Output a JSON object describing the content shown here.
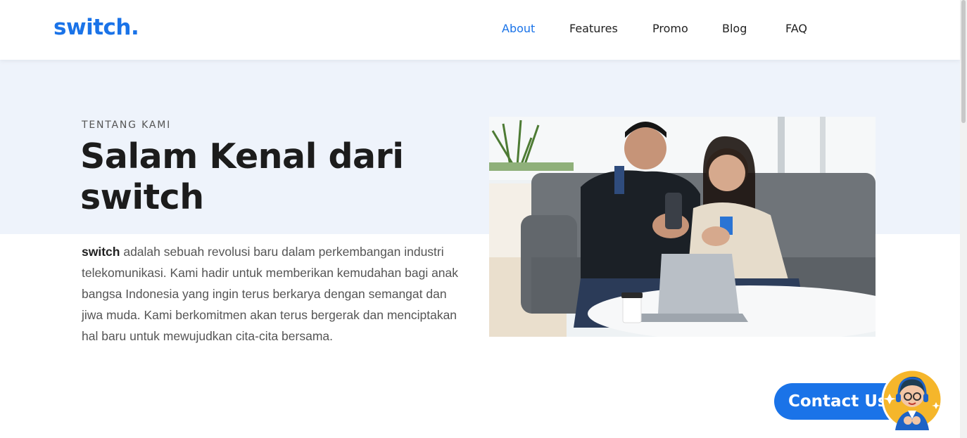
{
  "header": {
    "logo": "switch.",
    "nav": [
      {
        "label": "About",
        "active": true
      },
      {
        "label": "Features",
        "active": false
      },
      {
        "label": "Promo",
        "active": false
      },
      {
        "label": "Blog",
        "active": false
      },
      {
        "label": "FAQ",
        "active": false
      }
    ]
  },
  "about": {
    "eyebrow": "TENTANG KAMI",
    "title": "Salam Kenal dari switch",
    "description_brand": "switch",
    "description_rest": "adalah sebuah revolusi baru dalam perkembangan industri telekomunikasi. Kami hadir untuk memberikan kemudahan bagi anak bangsa Indonesia yang ingin terus berkarya dengan semangat dan jiwa muda. Kami berkomitmen akan terus bergerak dan menciptakan hal baru untuk mewujudkan cita-cita bersama."
  },
  "contact": {
    "label": "Contact Us"
  },
  "colors": {
    "accent": "#1a73e8",
    "band": "#eef3fb",
    "text_dark": "#1c1c1c",
    "text_body": "#555555"
  },
  "icons": {
    "avatar": "customer-service-avatar-icon"
  }
}
